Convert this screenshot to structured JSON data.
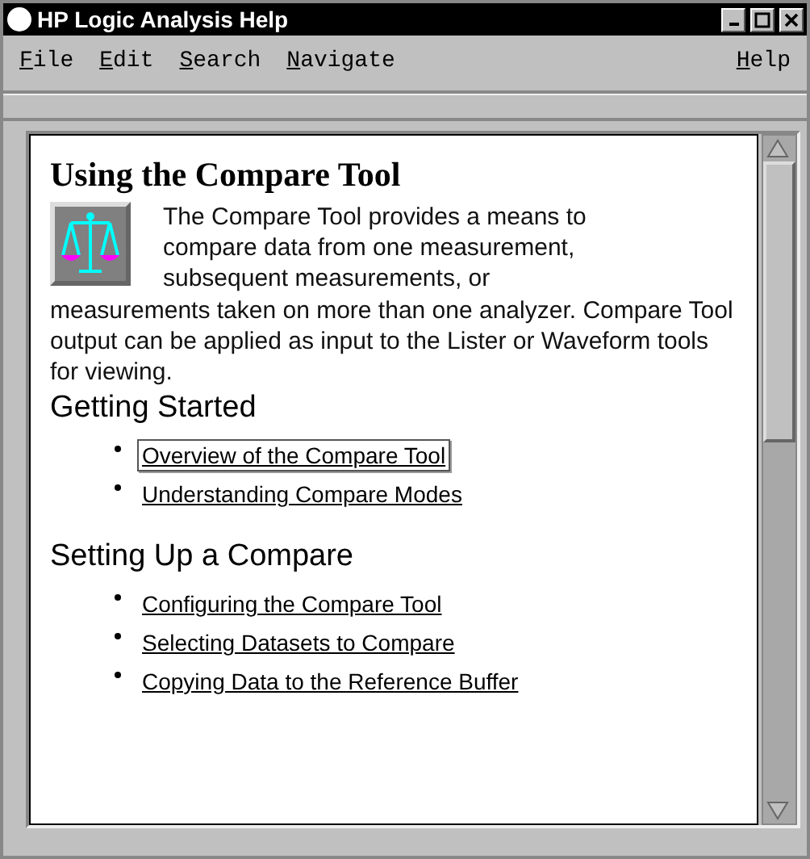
{
  "window": {
    "title": "HP Logic Analysis Help"
  },
  "menu": [
    {
      "label": "File"
    },
    {
      "label": "Edit"
    },
    {
      "label": "Search"
    },
    {
      "label": "Navigate"
    },
    {
      "label": "Help"
    }
  ],
  "document": {
    "title": "Using the Compare Tool",
    "intro": [
      "The Compare Tool provides a means to compare data from one measurement, subsequent measurements, or",
      "measurements taken on more than one analyzer. Compare Tool output can be applied as input to the Lister or Waveform tools for viewing."
    ],
    "sections": [
      {
        "heading": "Getting Started",
        "links": [
          {
            "text": "Overview of the Compare Tool",
            "selected": true
          },
          {
            "text": "Understanding Compare Modes",
            "selected": false
          }
        ]
      },
      {
        "heading": "Setting Up a Compare",
        "links": [
          {
            "text": "Configuring the Compare Tool",
            "selected": false
          },
          {
            "text": "Selecting Datasets to Compare",
            "selected": false
          },
          {
            "text": "Copying Data to the Reference Buffer",
            "selected": false
          }
        ]
      }
    ]
  }
}
